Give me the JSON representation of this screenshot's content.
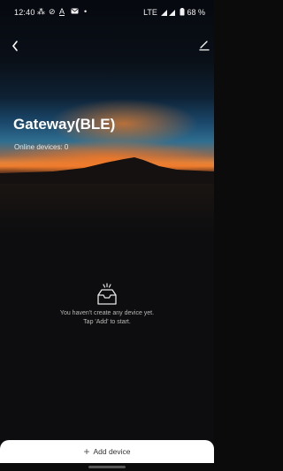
{
  "status_bar": {
    "time": "12:40",
    "network": "LTE",
    "battery": "68 %",
    "icons": [
      "nearby-share-icon",
      "do-not-disturb-icon",
      "text-a-icon",
      "mail-icon",
      "dot-icon",
      "signal-icon",
      "battery-icon"
    ]
  },
  "nav": {
    "back_icon": "chevron-left-icon",
    "edit_icon": "edit-icon"
  },
  "gateway": {
    "title": "Gateway(BLE)",
    "online_devices": "Online devices: 0"
  },
  "empty_state": {
    "icon": "empty-inbox-icon",
    "line1": "You haven't create any device yet.",
    "line2": "Tap 'Add' to start."
  },
  "add_bar": {
    "plus": "+",
    "label": "Add device"
  },
  "colors": {
    "background": "#0d0d0f",
    "sunset": "#f07e2e",
    "sky": "#2f6e90",
    "text_primary": "#ffffff",
    "text_muted": "#b9b9b9"
  }
}
